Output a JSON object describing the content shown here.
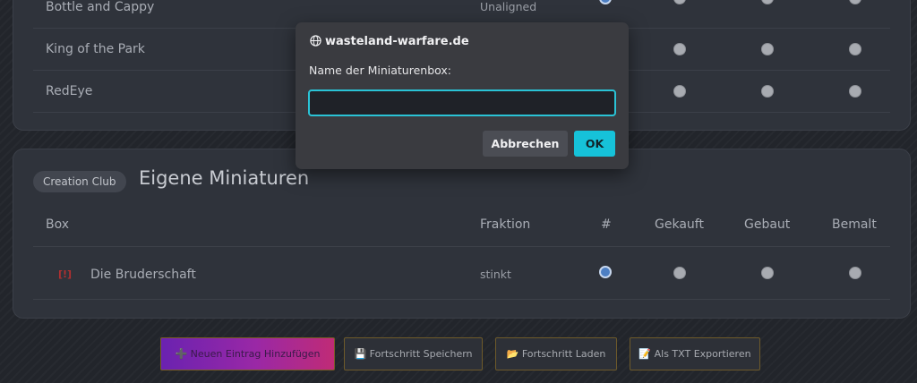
{
  "top_table": {
    "rows": [
      {
        "name": "Bottle and Cappy",
        "fraction": "Unaligned"
      },
      {
        "name": "King of the Park",
        "fraction": ""
      },
      {
        "name": "RedEye",
        "fraction": ""
      }
    ]
  },
  "custom_section": {
    "badge": "Creation Club",
    "title": "Eigene Miniaturen",
    "headers": {
      "box": "Box",
      "fraction": "Fraktion",
      "number": "#",
      "bought": "Gekauft",
      "built": "Gebaut",
      "painted": "Bemalt"
    },
    "rows": [
      {
        "icon_text": "[!]",
        "name": "Die Bruderschaft",
        "fraction": "stinkt"
      }
    ]
  },
  "buttons": {
    "add": "➕ Neuen Eintrag Hinzufügen",
    "save": "💾 Fortschritt Speichern",
    "load": "📂 Fortschritt Laden",
    "export": "📝 Als TXT Exportieren"
  },
  "dialog": {
    "site": "wasteland-warfare.de",
    "label": "Name der Miniaturenbox:",
    "input_value": "",
    "cancel": "Abbrechen",
    "ok": "OK"
  },
  "colors": {
    "accent": "#16c2d9",
    "radio_selected": "#4d7fc3"
  }
}
